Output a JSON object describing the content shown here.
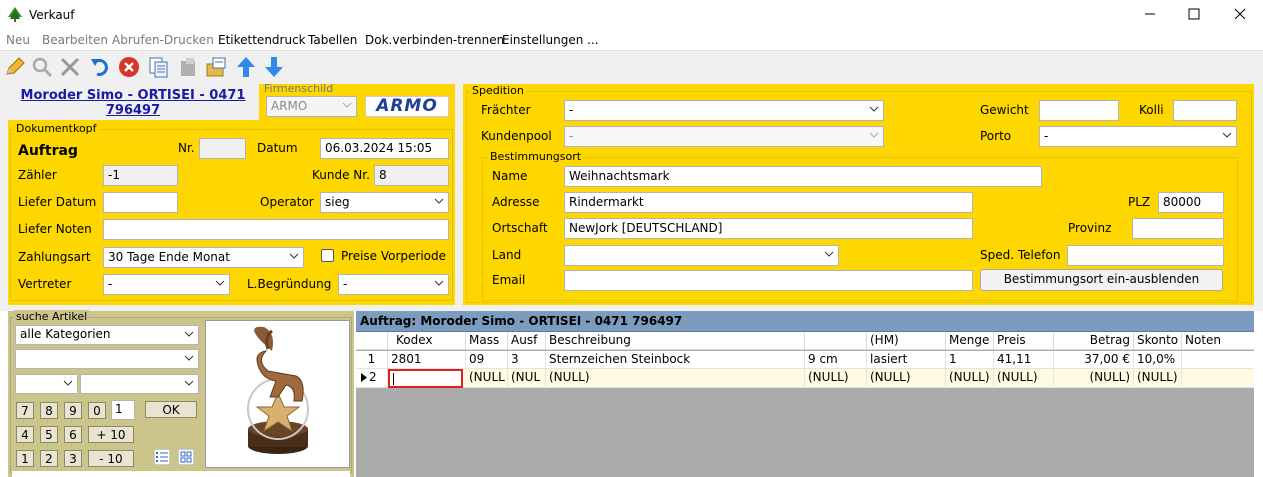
{
  "window": {
    "title": "Verkauf"
  },
  "menu": [
    "Neu",
    "Bearbeiten",
    "Abrufen-Drucken",
    "Etikettendruck",
    "Tabellen",
    "Dok.verbinden-trennen",
    "Einstellungen ..."
  ],
  "customer_link": "Moroder Simo - ORTISEI - 0471 796497",
  "firmenschild": {
    "title": "Firmenschild",
    "value": "ARMO",
    "logo": "ARMO"
  },
  "dokumentkopf": {
    "title": "Dokumentkopf",
    "doc_type": "Auftrag",
    "nr_label": "Nr.",
    "nr_value": "",
    "datum_label": "Datum",
    "datum_value": "06.03.2024 15:05",
    "zaehler_label": "Zähler",
    "zaehler_value": "-1",
    "kundennr_label": "Kunde Nr.",
    "kundennr_value": "8",
    "lieferdatum_label": "Liefer Datum",
    "lieferdatum_value": "",
    "operator_label": "Operator",
    "operator_value": "sieg",
    "liefernoten_label": "Liefer Noten",
    "liefernoten_value": "",
    "zahlungsart_label": "Zahlungsart",
    "zahlungsart_value": "30 Tage Ende Monat",
    "preise_label": "Preise Vorperiode",
    "vertreter_label": "Vertreter",
    "vertreter_value": "-",
    "lbegruendung_label": "L.Begründung",
    "lbegruendung_value": "-"
  },
  "spedition": {
    "title": "Spedition",
    "fraechter_label": "Frächter",
    "fraechter_value": "-",
    "kundenpool_label": "Kundenpool",
    "kundenpool_value": "-",
    "gewicht_label": "Gewicht",
    "gewicht_value": "",
    "kolli_label": "Kolli",
    "kolli_value": "",
    "porto_label": "Porto",
    "porto_value": "-",
    "bestimmungsort": {
      "title": "Bestimmungsort",
      "name_label": "Name",
      "name_value": "Weihnachtsmark",
      "adresse_label": "Adresse",
      "adresse_value": "Rindermarkt",
      "plz_label": "PLZ",
      "plz_value": "80000",
      "ortschaft_label": "Ortschaft",
      "ortschaft_value": "NewJork [DEUTSCHLAND]",
      "provinz_label": "Provinz",
      "provinz_value": "",
      "land_label": "Land",
      "land_value": "",
      "spedtel_label": "Sped. Telefon",
      "spedtel_value": "",
      "email_label": "Email",
      "email_value": "",
      "toggle_button": "Bestimmungsort ein-ausblenden"
    }
  },
  "suche": {
    "title": "suche Artikel",
    "kategorie": "alle Kategorien",
    "qty": "1",
    "ok": "OK",
    "keys": [
      "7",
      "8",
      "9",
      "0",
      "4",
      "5",
      "6",
      "+ 10",
      "1",
      "2",
      "3",
      "- 10"
    ]
  },
  "grid": {
    "title": "Auftrag: Moroder Simo - ORTISEI - 0471 796497",
    "columns": [
      "Kodex",
      "Mass",
      "Ausf",
      "Beschreibung",
      "",
      "(HM)",
      "Menge",
      "Preis",
      "Betrag",
      "Skonto",
      "Noten"
    ],
    "rows": [
      {
        "num": "1",
        "cells": [
          "2801",
          "09",
          "3",
          "Sternzeichen Steinbock",
          "9 cm",
          "lasiert",
          "1",
          "41,11",
          "37,00 €",
          "10,0%",
          ""
        ]
      },
      {
        "num": "2",
        "cells": [
          "",
          "(NULL",
          "(NUL",
          "(NULL)",
          "(NULL)",
          "(NULL)",
          "(NULL)",
          "(NULL)",
          "(NULL)",
          "(NULL)",
          ""
        ]
      }
    ]
  },
  "colors": {
    "panel": "#ffd700",
    "grid_header": "#7c9cbf",
    "active_row": "#fffbe0",
    "link": "#1a1aa6",
    "close_red": "#d9342b"
  }
}
